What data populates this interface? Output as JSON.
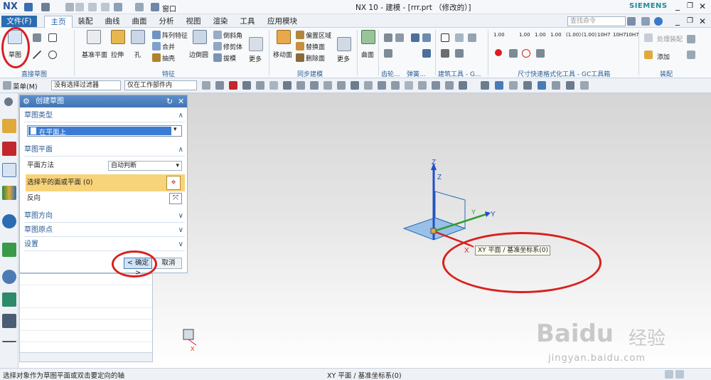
{
  "title_bar": {
    "logo": "NX",
    "window_menu": "窗口",
    "title": "NX 10 - 建模 - [rrr.prt （修改的）]",
    "brand": "SIEMENS"
  },
  "menu": {
    "file": "文件(F)",
    "tabs": [
      "主页",
      "装配",
      "曲线",
      "曲面",
      "分析",
      "视图",
      "渲染",
      "工具",
      "应用模块"
    ],
    "search_placeholder": "查找命令"
  },
  "ribbon": {
    "sketch": "草图",
    "datum_plane": "基准平面",
    "extrude": "拉伸",
    "hole": "孔",
    "array_feature": "阵列特征",
    "unite": "合并",
    "shell": "抽壳",
    "edge_blend": "边倒圆",
    "chamfer": "倒斜角",
    "trim_body": "修剪体",
    "draft": "拔模",
    "more1": "更多",
    "move_face": "移动面",
    "offset_region": "偏置区域",
    "replace_face": "替换面",
    "delete_face": "删除面",
    "more2": "更多",
    "surface": "曲面",
    "add_component": "添加",
    "make_asm": "处理装配",
    "groups": {
      "direct_sketch": "直接草图",
      "feature": "特征",
      "sync_modeling": "同步建模",
      "gear": "齿轮...",
      "spring": "弹簧...",
      "building_tools": "建筑工具 - G...",
      "dim_tools": "尺寸快速格式化工具 - GC工具箱",
      "assembly": "装配"
    },
    "dim_labels": [
      "1.00",
      "1.00",
      "1.00",
      "1.00",
      "(1.00)",
      "(1.00)",
      "10H7",
      "10H7",
      "10H7"
    ]
  },
  "toolbar2": {
    "menu": "菜单(M)",
    "filter": "没有选择过滤器",
    "scope": "仅在工作部件内"
  },
  "panel": {
    "title": "创建草图",
    "sections": {
      "type": "草图类型",
      "plane": "草图平面",
      "orientation": "草图方向",
      "origin": "草图原点",
      "settings": "设置"
    },
    "type_value": "在平面上",
    "plane_method_label": "平面方法",
    "plane_method_value": "自动判断",
    "select_plane": "选择平的面或平面 (0)",
    "reverse": "反向",
    "ok": "< 确定 >",
    "cancel": "取消"
  },
  "viewport": {
    "axes": {
      "x": "X",
      "y": "Y",
      "z": "Z"
    },
    "tooltip": "XY 平面 / 基准坐标系(0)"
  },
  "status": {
    "left": "选择对象作为草图平面或双击要定向的轴",
    "center": "XY 平面 / 基准坐标系(0)"
  },
  "watermark": {
    "brand": "Baidu",
    "cn": "经验",
    "url": "jingyan.baidu.com"
  },
  "colors": {
    "accent": "#2b6cb0",
    "highlight_row": "#f7d37a",
    "annotation": "#d9201e",
    "axis_x": "#d9201e",
    "axis_y": "#2e9d2e",
    "axis_z": "#1f4fc9"
  }
}
